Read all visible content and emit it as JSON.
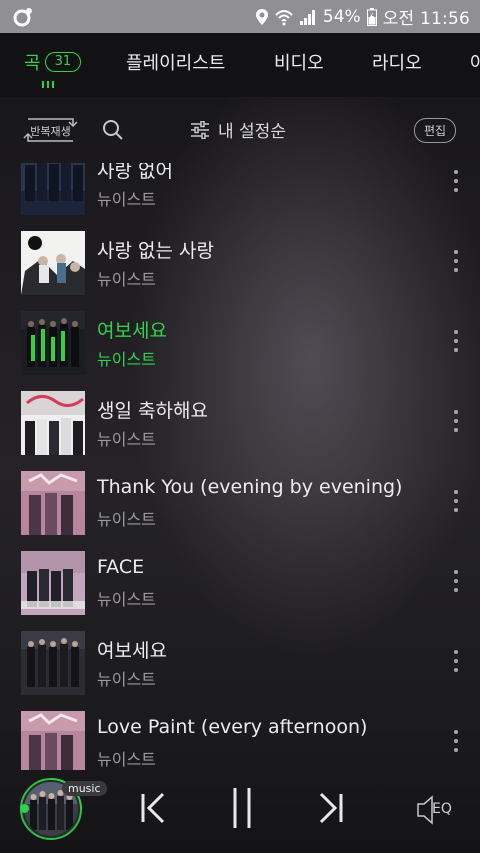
{
  "status_bar": {
    "battery": "54%",
    "time": "오전 11:56"
  },
  "tabs": [
    {
      "label": "곡",
      "badge": "31",
      "active": true
    },
    {
      "label": "플레이리스트"
    },
    {
      "label": "비디오"
    },
    {
      "label": "라디오"
    },
    {
      "label": "아"
    }
  ],
  "toolbar": {
    "repeat_label": "반복재생",
    "sort_label": "내 설정순",
    "edit_label": "편집"
  },
  "songs": [
    {
      "title": "사랑 없어",
      "artist": "뉴이스트",
      "art": "art-a"
    },
    {
      "title": "사랑 없는 사랑",
      "artist": "뉴이스트",
      "art": "art-b"
    },
    {
      "title": "여보세요",
      "artist": "뉴이스트",
      "art": "art-c",
      "playing": true
    },
    {
      "title": "생일 축하해요",
      "artist": "뉴이스트",
      "art": "art-d"
    },
    {
      "title": "Thank You (evening by evening)",
      "artist": "뉴이스트",
      "art": "art-e"
    },
    {
      "title": "FACE",
      "artist": "뉴이스트",
      "art": "art-f"
    },
    {
      "title": "여보세요",
      "artist": "뉴이스트",
      "art": "art-c"
    },
    {
      "title": "Love Paint (every afternoon)",
      "artist": "뉴이스트",
      "art": "art-e"
    }
  ],
  "player": {
    "music_tag": "music",
    "eq_label": "EQ"
  },
  "colors": {
    "accent": "#2fd34a",
    "status_bar": "#8f8f94",
    "background": "#1e1c20"
  }
}
